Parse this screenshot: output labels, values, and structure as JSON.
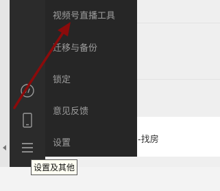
{
  "menu": {
    "items": [
      {
        "label": "视频号直播工具"
      },
      {
        "label": "迁移与备份"
      },
      {
        "label": "锁定"
      },
      {
        "label": "意见反馈"
      },
      {
        "label": "设置"
      }
    ]
  },
  "background": {
    "partial_text": "-找房"
  },
  "tooltip": {
    "text": "设置及其他"
  },
  "sidebar": {
    "icons": [
      "mini-program-icon",
      "phone-icon",
      "menu-icon"
    ]
  },
  "colors": {
    "sidebar_bg": "#2b2b2b",
    "menu_bg": "#262626",
    "menu_text": "#9e9e9e",
    "annotation_arrow": "#8b0b0b"
  }
}
